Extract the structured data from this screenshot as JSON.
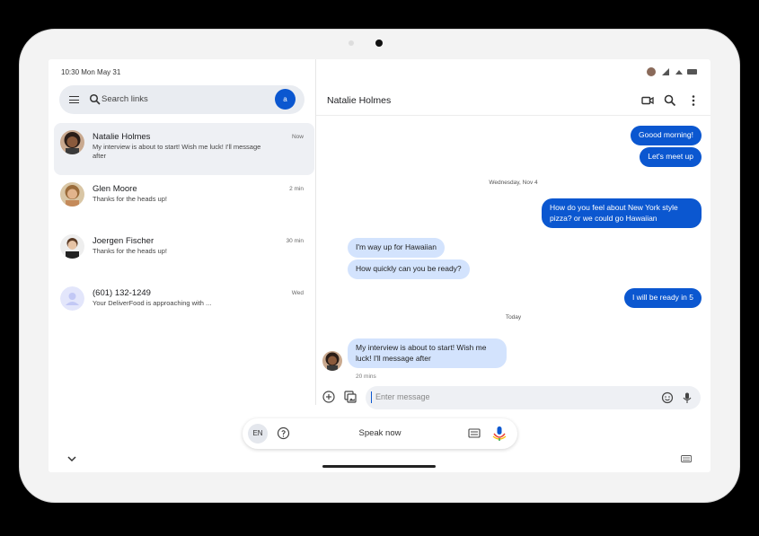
{
  "status": {
    "time": "10:30",
    "date": "Mon May 31"
  },
  "search": {
    "placeholder": "Search links",
    "avatar_letter": "a"
  },
  "conversations": [
    {
      "name": "Natalie Holmes",
      "snippet": "My interview is about to start! Wish me luck! I'll message after",
      "time": "Now",
      "active": true
    },
    {
      "name": "Glen Moore",
      "snippet": "Thanks for the heads up!",
      "time": "2 min"
    },
    {
      "name": "Joergen Fischer",
      "snippet": "Thanks for the heads up!",
      "time": "30 min"
    },
    {
      "name": "(601) 132-1249",
      "snippet": "Your DeliverFood is approaching with ...",
      "time": "Wed"
    }
  ],
  "thread": {
    "title": "Natalie Holmes",
    "messages": [
      {
        "dir": "out",
        "text": "Goood morning!"
      },
      {
        "dir": "out",
        "text": "Let's meet up"
      },
      {
        "dir": "date",
        "text": "Wednesday, Nov 4"
      },
      {
        "dir": "out",
        "text": "How do you feel about New York style pizza? or we could go Hawaiian"
      },
      {
        "dir": "in",
        "text": "I'm way up for Hawaiian"
      },
      {
        "dir": "in",
        "text": "How quickly can you be ready?"
      },
      {
        "dir": "out",
        "text": "I will be ready in 5"
      },
      {
        "dir": "date",
        "text": "Today"
      },
      {
        "dir": "in",
        "text": "My interview is about to start! Wish me luck! I'll message after"
      }
    ],
    "last_meta": "20 mins"
  },
  "compose": {
    "placeholder": "Enter message"
  },
  "voice_ime": {
    "language": "EN",
    "prompt": "Speak now"
  },
  "colors": {
    "accent": "#0b57d0",
    "incoming_bubble": "#d3e3fd",
    "active_row": "#eef0f4"
  },
  "icons": [
    "menu-icon",
    "search-icon",
    "video-call-icon",
    "more-vert-icon",
    "add-icon",
    "gallery-icon",
    "emoji-icon",
    "mic-icon",
    "help-icon",
    "keyboard-icon",
    "chevron-down-icon"
  ]
}
